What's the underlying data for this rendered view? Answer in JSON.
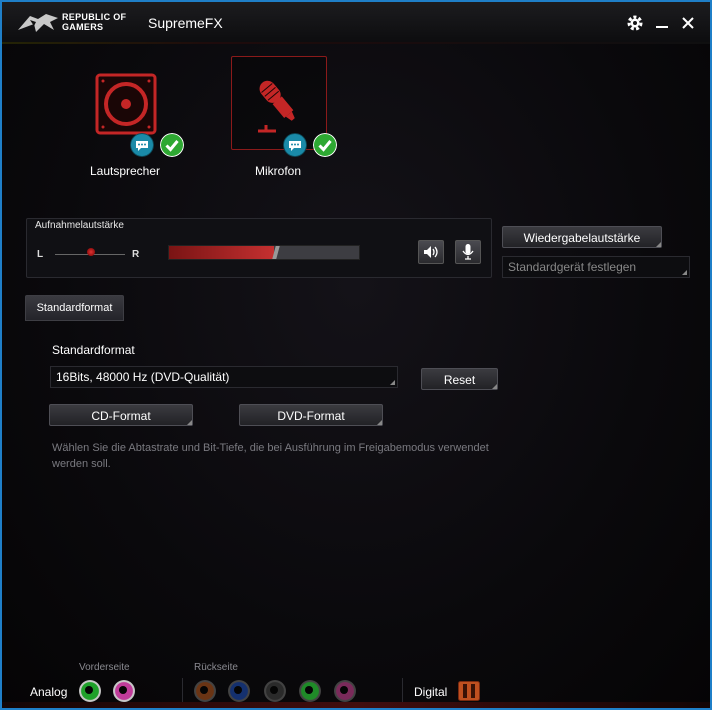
{
  "titlebar": {
    "brand_line1": "REPUBLIC OF",
    "brand_line2": "GAMERS",
    "app_title": "SupremeFX",
    "icons": [
      "rog-logo-icon",
      "gear-icon",
      "minimize-icon",
      "close-icon"
    ]
  },
  "devices": [
    {
      "label": "Lautsprecher",
      "icon": "speaker-icon",
      "selected": false,
      "badges": [
        "chat-bubble-icon",
        "checkmark-icon"
      ]
    },
    {
      "label": "Mikrofon",
      "icon": "microphone-icon",
      "selected": true,
      "badges": [
        "chat-bubble-icon",
        "checkmark-icon"
      ]
    }
  ],
  "recording": {
    "title": "Aufnahmelautstärke",
    "left_label": "L",
    "right_label": "R",
    "volume_level": 0.55,
    "balance": 0.5
  },
  "playback": {
    "button_label": "Wiedergabelautstärke",
    "default_device_label": "Standardgerät festlegen"
  },
  "tabs": {
    "active": "Standardformat"
  },
  "format": {
    "heading": "Standardformat",
    "selected": "16Bits, 48000 Hz (DVD-Qualität)",
    "reset_label": "Reset",
    "cd_label": "CD-Format",
    "dvd_label": "DVD-Format",
    "description": "Wählen Sie die Abtastrate und Bit-Tiefe, die bei Ausführung im Freigabemodus verwendet werden soll."
  },
  "footer": {
    "analog_label": "Analog",
    "front_label": "Vorderseite",
    "rear_label": "Rückseite",
    "digital_label": "Digital",
    "front_jacks": [
      "#1fa02a",
      "#c03c9a"
    ],
    "rear_jacks": [
      "#6a3414",
      "#14306e",
      "#2a2a2a",
      "#1f8a28",
      "#7a2a5a"
    ]
  },
  "colors": {
    "accent_red": "#c42626",
    "window_border": "#1f7fc8",
    "check_green": "#2ea832",
    "chat_teal": "#1a8aa8"
  }
}
